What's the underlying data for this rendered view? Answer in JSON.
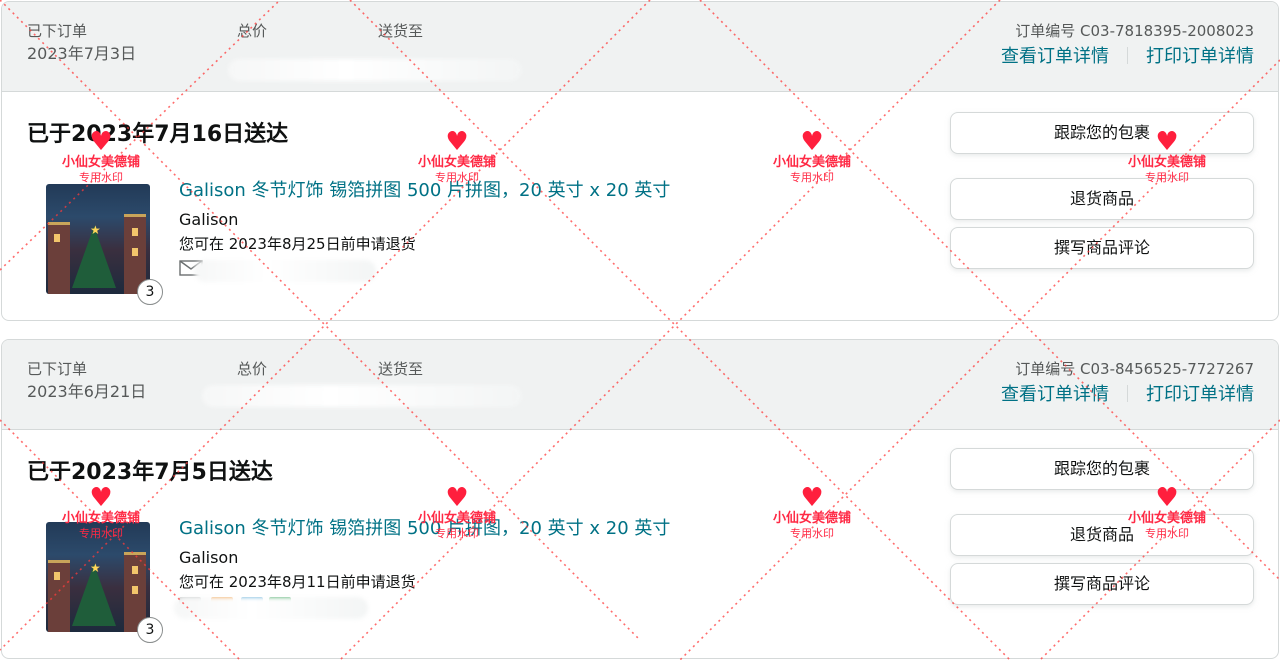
{
  "orders": [
    {
      "header": {
        "placed_label": "已下订单",
        "placed_date": "2023年7月3日",
        "total_label": "总价",
        "ship_to_label": "送货至",
        "order_number": "订单编号 C03-7818395-2008023",
        "view_details": "查看订单详情",
        "print_details": "打印订单详情"
      },
      "status": "已于2023年7月16日送达",
      "item": {
        "title": "Galison 冬节灯饰 锡箔拼图 500 片拼图，20 英寸 x 20 英寸",
        "brand": "Galison",
        "return_note": "您可在 2023年8月25日前申请退货",
        "quantity": "3",
        "gift_icon": "mail-icon"
      },
      "buttons": [
        "跟踪您的包裹",
        "退货商品",
        "撰写商品评论"
      ]
    },
    {
      "header": {
        "placed_label": "已下订单",
        "placed_date": "2023年6月21日",
        "total_label": "总价",
        "ship_to_label": "送货至",
        "order_number": "订单编号 C03-8456525-7727267",
        "view_details": "查看订单详情",
        "print_details": "打印订单详情"
      },
      "status": "已于2023年7月5日送达",
      "item": {
        "title": "Galison 冬节灯饰 锡箔拼图 500 片拼图，20 英寸 x 20 英寸",
        "brand": "Galison",
        "return_note": "您可在 2023年8月11日前申请退货",
        "quantity": "3"
      },
      "buttons": [
        "跟踪您的包裹",
        "退货商品",
        "撰写商品评论"
      ]
    }
  ],
  "watermark": {
    "shop": "小仙女美德铺",
    "stamp": "专用水印",
    "icon": "heart-icon"
  },
  "colors": {
    "link": "#007185",
    "header_bg": "#f0f2f2",
    "border": "#d5d9d9",
    "watermark": "#ff2a45"
  }
}
